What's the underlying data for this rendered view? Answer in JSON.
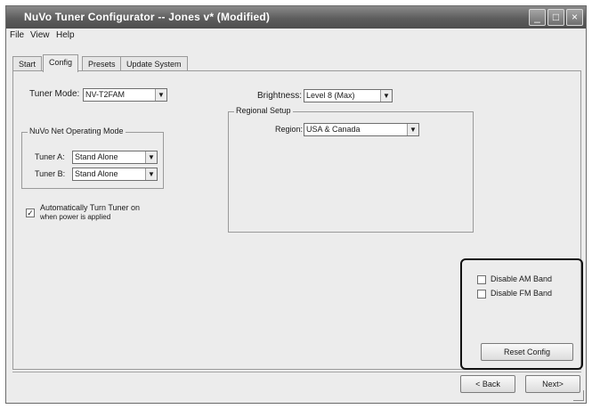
{
  "window": {
    "title": "NuVo Tuner Configurator -- Jones v* (Modified)",
    "minimize": "_",
    "maximize": "□",
    "close": "×"
  },
  "menu": {
    "file": "File",
    "view": "View",
    "help": "Help"
  },
  "tabs": [
    {
      "label": "Start"
    },
    {
      "label": "Config"
    },
    {
      "label": "Presets"
    },
    {
      "label": "Update System"
    }
  ],
  "config": {
    "tuner_mode_label": "Tuner Mode:",
    "tuner_mode_value": "NV-T2FAM",
    "operating_mode": {
      "legend": "NuVo Net Operating Mode",
      "tuner_a_label": "Tuner A:",
      "tuner_a_value": "Stand Alone",
      "tuner_b_label": "Tuner B:",
      "tuner_b_value": "Stand Alone"
    },
    "auto_turn_on": {
      "checked": true,
      "label_line1": "Automatically Turn Tuner on",
      "label_line2": "when power is applied"
    },
    "brightness_label": "Brightness:",
    "brightness_value": "Level 8 (Max)",
    "regional": {
      "legend": "Regional Setup",
      "region_label": "Region:",
      "region_value": "USA & Canada"
    },
    "band": {
      "disable_am": "Disable AM Band",
      "disable_fm": "Disable FM Band",
      "am_checked": false,
      "fm_checked": false
    },
    "reset_button": "Reset Config"
  },
  "footer": {
    "back_button": "< Back",
    "next_button": "Next>"
  },
  "icons": {
    "dropdown_arrow": "▼",
    "check_mark": "✓"
  }
}
